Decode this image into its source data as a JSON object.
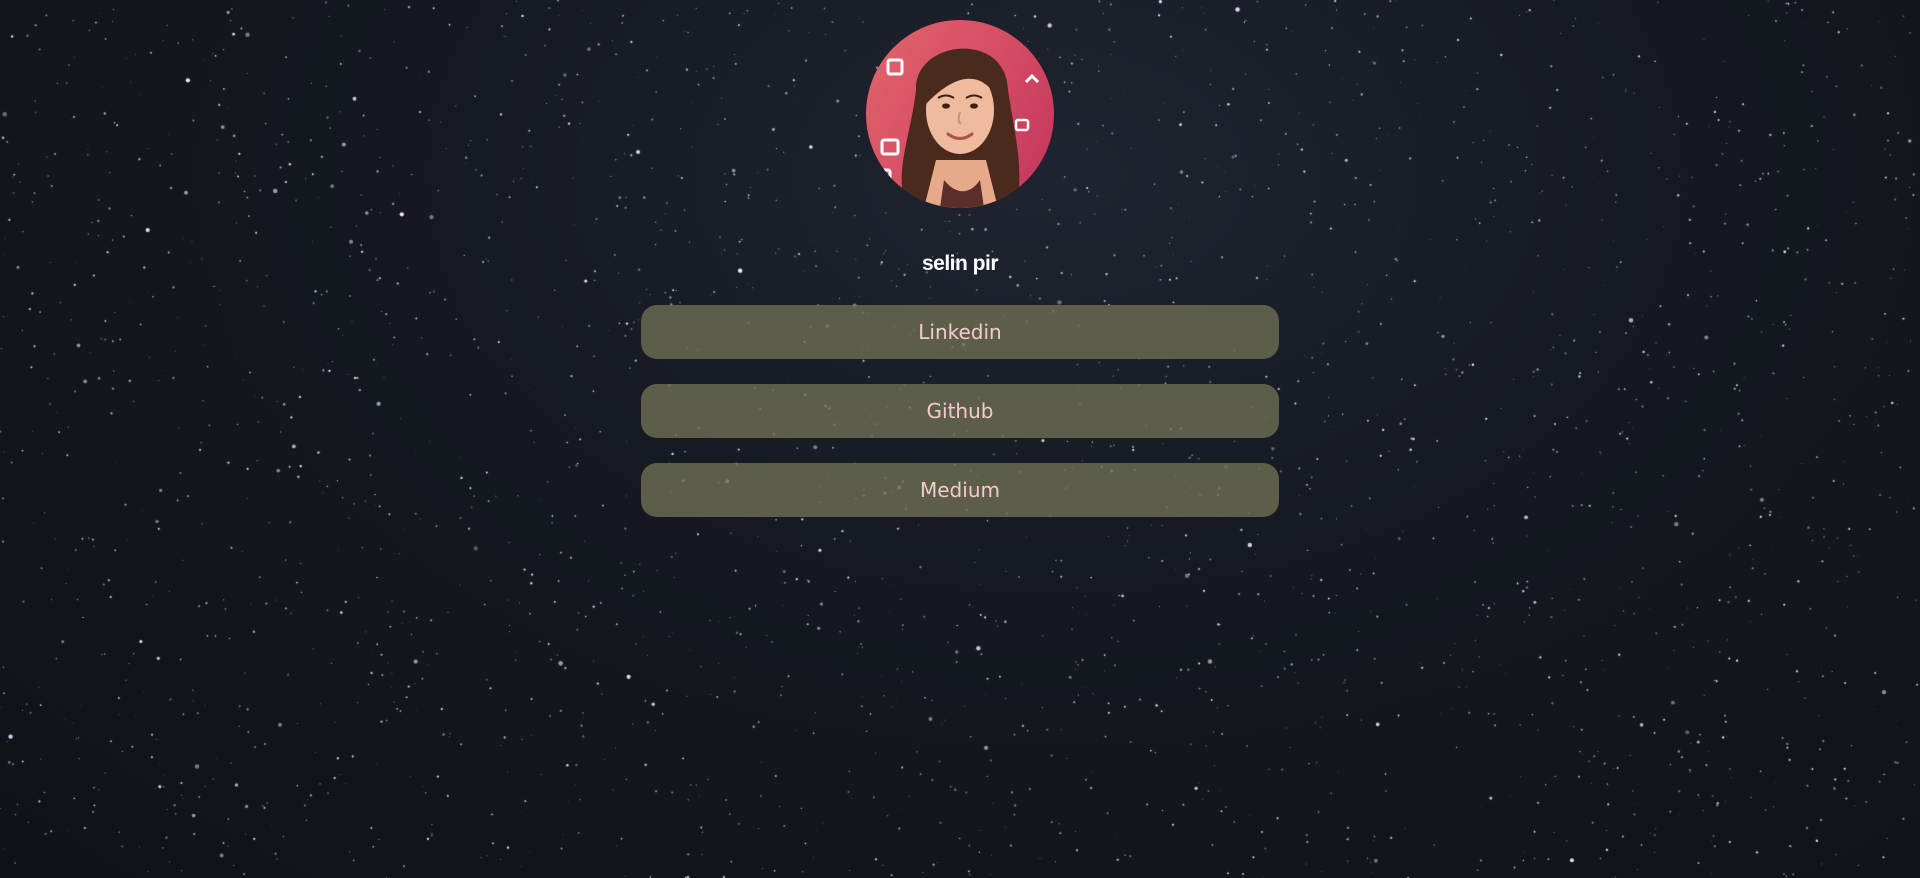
{
  "profile": {
    "name": "selin pir",
    "avatar_icon": "profile-photo"
  },
  "links": [
    {
      "label": "Linkedin"
    },
    {
      "label": "Github"
    },
    {
      "label": "Medium"
    }
  ],
  "colors": {
    "background": "#13161d",
    "button_bg": "#6c6c52",
    "button_text": "#f4c9cf",
    "name_text": "#ffffff"
  }
}
